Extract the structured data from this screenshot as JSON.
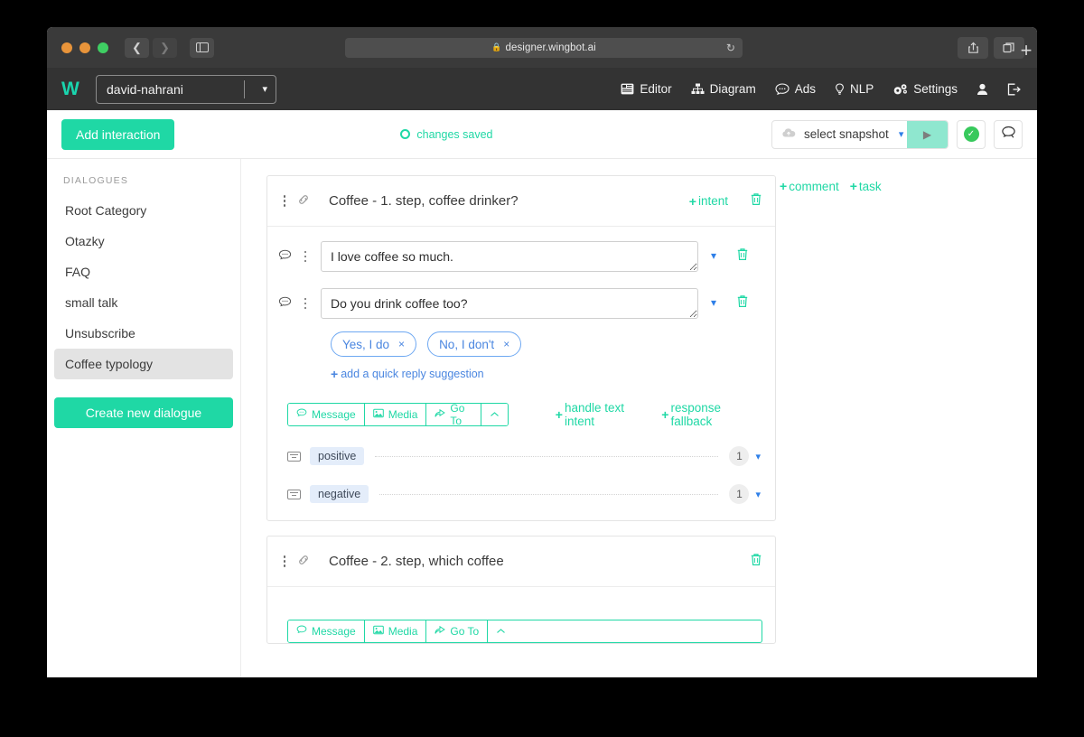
{
  "browser": {
    "url": "designer.wingbot.ai",
    "lock_icon": "lock-icon",
    "reload_icon": "reload-icon",
    "back_icon": "back-arrow-icon",
    "forward_icon": "forward-arrow-icon",
    "sidebar_icon": "sidebar-toggle-icon",
    "share_icon": "share-icon",
    "tabs_icon": "tab-overview-icon",
    "newtab_label": "+"
  },
  "appbar": {
    "logo": "W",
    "project": "david-nahrani",
    "project_chevron": "⌄",
    "nav": [
      {
        "label": "Editor",
        "icon": "editor-icon"
      },
      {
        "label": "Diagram",
        "icon": "diagram-icon"
      },
      {
        "label": "Ads",
        "icon": "ads-chat-icon"
      },
      {
        "label": "NLP",
        "icon": "nlp-bulb-icon"
      },
      {
        "label": "Settings",
        "icon": "settings-gear-icon"
      }
    ],
    "account_icon": "user-icon",
    "logout_icon": "logout-icon"
  },
  "toolbar": {
    "add_interaction": "Add interaction",
    "status": "changes saved",
    "snapshot_placeholder": "select snapshot",
    "snapshot_icon": "cloud-upload-icon",
    "snapshot_chevron": "⌄",
    "play_icon": "▶",
    "deploy_ok_icon": "check-circle-icon",
    "comments_icon": "comment-bubble-icon"
  },
  "sidebar": {
    "title": "DIALOGUES",
    "items": [
      {
        "label": "Root Category",
        "active": false
      },
      {
        "label": "Otazky",
        "active": false
      },
      {
        "label": "FAQ",
        "active": false
      },
      {
        "label": "small talk",
        "active": false
      },
      {
        "label": "Unsubscribe",
        "active": false
      },
      {
        "label": "Coffee typology",
        "active": true
      }
    ],
    "create_button": "Create new dialogue"
  },
  "side_notes": {
    "comment": "comment",
    "task": "task",
    "plus": "+"
  },
  "cards": [
    {
      "title": "Coffee - 1. step, coffee drinker?",
      "intent_label": "intent",
      "menu_icon": "kebab-menu-icon",
      "link_icon": "chain-link-icon",
      "delete_icon": "trash-icon",
      "messages": [
        {
          "value": "I love coffee so much.",
          "icon": "chat-bubble-icon"
        },
        {
          "value": "Do you drink coffee too?",
          "icon": "chat-bubble-icon"
        }
      ],
      "quick_replies": [
        {
          "label": "Yes, I do",
          "remove": "×"
        },
        {
          "label": "No, I don't",
          "remove": "×"
        }
      ],
      "quick_reply_add": "add a quick reply suggestion",
      "action_buttons": [
        {
          "label": "Message",
          "icon": "chat-bubble-icon"
        },
        {
          "label": "Media",
          "icon": "image-icon"
        },
        {
          "label": "Go To",
          "icon": "goto-arrow-icon"
        }
      ],
      "collapse_icon": "^",
      "action_links": [
        {
          "label": "handle text intent"
        },
        {
          "label": "response fallback"
        }
      ],
      "connections": [
        {
          "label": "positive",
          "count": "1",
          "icon": "keyboard-icon",
          "chevron": "⌄"
        },
        {
          "label": "negative",
          "count": "1",
          "icon": "keyboard-icon",
          "chevron": "⌄"
        }
      ]
    },
    {
      "title": "Coffee - 2. step, which coffee",
      "menu_icon": "kebab-menu-icon",
      "link_icon": "chain-link-icon",
      "delete_icon": "trash-icon",
      "action_buttons": [
        {
          "label": "Message",
          "icon": "chat-bubble-icon"
        },
        {
          "label": "Media",
          "icon": "image-icon"
        },
        {
          "label": "Go To",
          "icon": "goto-arrow-icon"
        }
      ],
      "collapse_icon": "^"
    }
  ],
  "colors": {
    "accent": "#1fd8a5",
    "blue": "#4a86e0",
    "chrome": "#3a3a3a",
    "appbar": "#333333"
  }
}
